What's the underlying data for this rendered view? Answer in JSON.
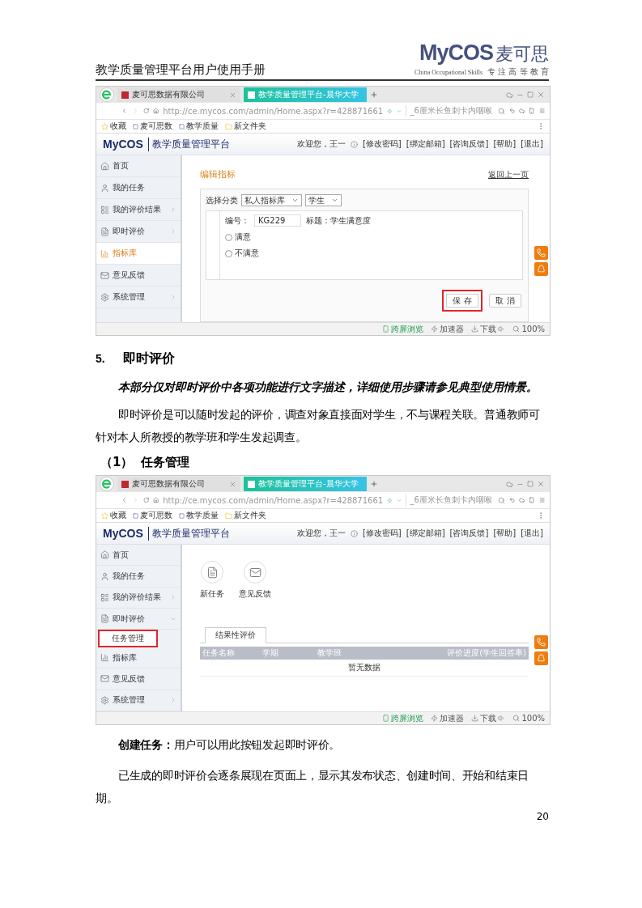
{
  "header": {
    "title": "教学质量管理平台用户使用手册",
    "logo": {
      "mark": "MyCOS",
      "name": "麦可思",
      "tagline_en": "China Occupational Skills",
      "tagline_cn": "专 注 高 等 教 育"
    }
  },
  "blocks": [
    {
      "kind": "screenshot",
      "browser": {
        "tabs": [
          {
            "label": "麦可思数据有限公司",
            "selected": false
          },
          {
            "label": "教学质量管理平台-晨华大学",
            "selected": true
          }
        ],
        "url": "http://ce.mycos.com/admin/Home.aspx?r=428871661",
        "search": "_6厘米长鱼刺卡内咽喉",
        "bookmarks": [
          "收藏",
          "麦可思数",
          "教学质量",
          "新文件夹"
        ],
        "status": [
          "跨屏浏览",
          "加速器",
          "下载",
          "100%"
        ]
      },
      "app": {
        "logo": "MyCOS",
        "title": "教学质量管理平台",
        "welcome": "欢迎您，王一",
        "links": [
          "[修改密码]",
          "[绑定邮箱]",
          "[咨询反馈]",
          "[帮助]",
          "[退出]"
        ]
      },
      "sidebar": [
        {
          "label": "首页",
          "expandable": false,
          "selected": false
        },
        {
          "label": "我的任务",
          "expandable": false,
          "selected": false
        },
        {
          "label": "我的评价结果",
          "expandable": true,
          "expanded": false,
          "selected": false
        },
        {
          "label": "即时评价",
          "expandable": true,
          "expanded": false,
          "selected": false
        },
        {
          "label": "指标库",
          "expandable": false,
          "selected": true
        },
        {
          "label": "意见反馈",
          "expandable": false,
          "selected": false
        },
        {
          "label": "系统管理",
          "expandable": true,
          "expanded": false,
          "selected": false
        }
      ],
      "main": {
        "kind": "edit_form",
        "title": "编辑指标",
        "back_link": "返回上一页",
        "category_label": "选择分类",
        "selects": [
          "私人指标库",
          "学生"
        ],
        "code_label": "编号：",
        "code_value": "KG229",
        "title_label": "标题：学生满意度",
        "options": [
          {
            "label": "满意",
            "selected": false
          },
          {
            "label": "不满意",
            "selected": false
          }
        ],
        "buttons": [
          {
            "label": "保 存",
            "highlighted": true
          },
          {
            "label": "取 消",
            "highlighted": false
          }
        ]
      }
    },
    {
      "kind": "heading",
      "number": "5.",
      "text": "即时评价"
    },
    {
      "kind": "note",
      "text": "本部分仅对即时评价中各项功能进行文字描述，详细使用步骤请参见典型使用情景。"
    },
    {
      "kind": "paragraph",
      "text": "即时评价是可以随时发起的评价，调查对象直接面对学生，不与课程关联。普通教师可针对本人所教授的教学班和学生发起调查。"
    },
    {
      "kind": "subheading",
      "number": "（1）",
      "text": "任务管理"
    },
    {
      "kind": "screenshot",
      "browser": {
        "tabs": [
          {
            "label": "麦可思数据有限公司",
            "selected": false
          },
          {
            "label": "教学质量管理平台-晨华大学",
            "selected": true
          }
        ],
        "url": "http://ce.mycos.com/admin/Home.aspx?r=428871661",
        "search": "_6厘米长鱼刺卡内咽喉",
        "bookmarks": [
          "收藏",
          "麦可思数",
          "教学质量",
          "新文件夹"
        ],
        "status": [
          "跨屏浏览",
          "加速器",
          "下载",
          "100%"
        ]
      },
      "app": {
        "logo": "MyCOS",
        "title": "教学质量管理平台",
        "welcome": "欢迎您，王一",
        "links": [
          "[修改密码]",
          "[绑定邮箱]",
          "[咨询反馈]",
          "[帮助]",
          "[退出]"
        ]
      },
      "sidebar": [
        {
          "label": "首页",
          "expandable": false,
          "selected": false
        },
        {
          "label": "我的任务",
          "expandable": false,
          "selected": false
        },
        {
          "label": "我的评价结果",
          "expandable": true,
          "expanded": false,
          "selected": false
        },
        {
          "label": "即时评价",
          "expandable": true,
          "expanded": true,
          "selected": false,
          "children": [
            {
              "label": "任务管理",
              "selected": true,
              "highlighted": true
            }
          ]
        },
        {
          "label": "指标库",
          "expandable": false,
          "selected": false
        },
        {
          "label": "意见反馈",
          "expandable": false,
          "selected": false
        },
        {
          "label": "系统管理",
          "expandable": true,
          "expanded": false,
          "selected": false
        }
      ],
      "main": {
        "kind": "task_list",
        "actions": [
          "新任务",
          "意见反馈"
        ],
        "tabs": [
          {
            "label": "结果性评价",
            "selected": true
          }
        ],
        "columns": [
          "任务名称",
          "学期",
          "教学班",
          "评价进度(学生回答率)"
        ],
        "empty": "暂无数据"
      }
    },
    {
      "kind": "paragraph",
      "text": "**创建任务：**用户可以用此按钮发起即时评价。"
    },
    {
      "kind": "paragraph",
      "text": "已生成的即时评价会逐条展现在页面上，显示其发布状态、创建时间、开始和结束日期。"
    }
  ],
  "page_number": "20"
}
